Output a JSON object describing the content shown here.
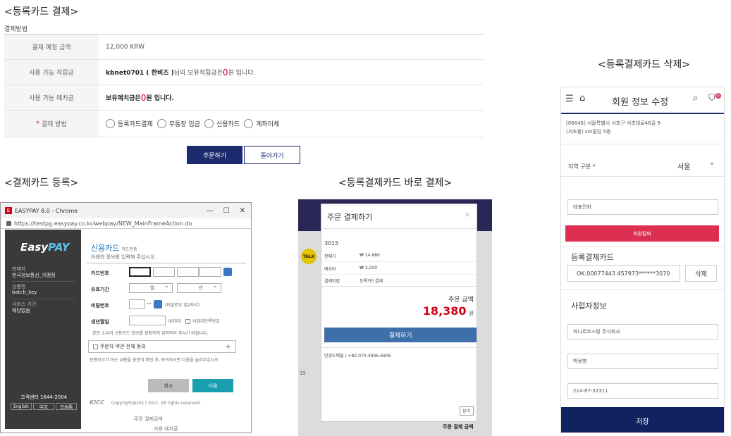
{
  "section1": {
    "title": "<등록카드 결제>",
    "small_label": "결제방법",
    "rows": [
      {
        "label": "결제 예정 금액",
        "value": "12,000 KRW"
      },
      {
        "label": "사용 가능 적립금",
        "user": "kbnet0701 ( 한비즈 )",
        "text_a": "님의 보유적립금은 ",
        "amount": "0",
        "text_b": "원 입니다."
      },
      {
        "label": "사용 가능 예치금",
        "text_a": "보유예치금은 ",
        "amount": "0",
        "text_b": "원 입니다."
      },
      {
        "label": "결제 방법",
        "required": "*"
      }
    ],
    "methods": [
      "등록카드결제",
      "무통장 입금",
      "신용카드",
      "계좌이체"
    ],
    "order_button": "주문하기",
    "back_button": "돌아가기"
  },
  "section2": {
    "title": "<결제카드 등록>",
    "window_title": "EASYPAY 8.0 - Chrome",
    "window_icon": "E",
    "url": "https://testpg.easypay.co.kr/webpay/NEW_MainFrameAction.do",
    "window_controls": [
      "—",
      "☐",
      "✕"
    ],
    "brand_a": "Easy",
    "brand_b": "PAY",
    "side": [
      {
        "label": "판매자",
        "value": "한국정보통신_가맹점"
      },
      {
        "label": "상품명",
        "value": "batch_key"
      },
      {
        "label": "서비스 기간",
        "value": "해당없음"
      }
    ],
    "cs": "고객센터 1644-2004",
    "langs": [
      "English",
      "中文",
      "日本語"
    ],
    "heading": "신용카드",
    "heading_sub": "카드인증",
    "instruction": "아래의 정보를 입력해 주십시오.",
    "fields": {
      "card_number": "카드번호",
      "expiry": "유효기간",
      "month": "월",
      "year": "년",
      "password": "비밀번호",
      "password_hint": "(비밀번호 앞2자리)",
      "birth": "생년월일",
      "birth_hint": "(6자리)",
      "corp_card": "사업자등록번호"
    },
    "notice": "본인 소유의 신용카드 정보를 정확하게 입력하여 주시기 바랍니다.",
    "agree": "주문자 약관 전체 동의",
    "agree_note": "진행하고자 하는 내용을 충분히 확인 후, 동의하시면 다음을 눌러주십시오.",
    "cancel": "취소",
    "next": "다음",
    "footer_brand": "KICC",
    "copyright": "Copyright@2017 KICC. All rights reserved.",
    "bg_peek": [
      "주문 결제금액",
      "사용 예치금"
    ]
  },
  "section3": {
    "title": "<등록결제카드 바로 결제>",
    "modal_title": "주문 결제하기",
    "close_x": "×",
    "order_no": "3015",
    "rows": [
      {
        "label": "판매가",
        "value": "₩ 14,880"
      },
      {
        "label": "배송비",
        "value": "₩ 3,500"
      },
      {
        "label": "결제방법",
        "value": "등록카드결제"
      }
    ],
    "sum_label": "주문 금액",
    "sum_value": "18,380",
    "sum_unit": "원",
    "pay_button": "결제하기",
    "contact": "안경도매울 / +82-070-4946-6906",
    "close_button": "닫기",
    "peek": [
      "TALK",
      "15",
      "주문 결제 금액"
    ]
  },
  "section4": {
    "title": "<등록결제카드 삭제>",
    "header_title": "회원 정보 수정",
    "cart_count": "0",
    "address_line1": "[06646] 서울특별시 서초구 서초대로46길 9",
    "address_line2": "(서초동) sm빌딩 5층",
    "region_label": "지역 구분 *",
    "region_value": "서울",
    "rep_phone": "대표전화",
    "withdraw": "회원탈퇴",
    "card_section": "등록결제카드",
    "card_value": "OK:00077443 457973******3070",
    "delete": "삭제",
    "biz_section": "사업자정보",
    "biz_name": "하나로호스팅 주식회사",
    "biz_owner": "박용병",
    "biz_number": "214-87-32311",
    "save": "저장"
  }
}
